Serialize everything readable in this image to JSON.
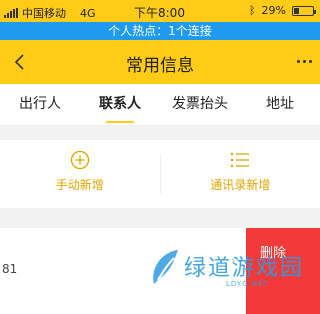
{
  "status_bar": {
    "carrier": "中国移动",
    "network": "4G",
    "time": "下午8:00",
    "battery": "29%",
    "battery_level": 0.29
  },
  "hotspot": {
    "text": "个人热点：1个连接"
  },
  "nav": {
    "title": "常用信息"
  },
  "tabs": [
    {
      "label": "出行人"
    },
    {
      "label": "联系人",
      "active": true
    },
    {
      "label": "发票抬头"
    },
    {
      "label": "地址"
    }
  ],
  "actions": {
    "manual_add": "手动新增",
    "contacts_add": "通讯录新增"
  },
  "contact_row": {
    "number_fragment": "81",
    "delete_label": "删除"
  },
  "watermark": {
    "text": "绿道游戏园",
    "sub": "LDYG.NET"
  },
  "colors": {
    "brand_yellow": "#fecc16",
    "hotspot_blue": "#1e9bf0",
    "accent_orange": "#e0a400",
    "delete_red": "#f23a3a"
  }
}
